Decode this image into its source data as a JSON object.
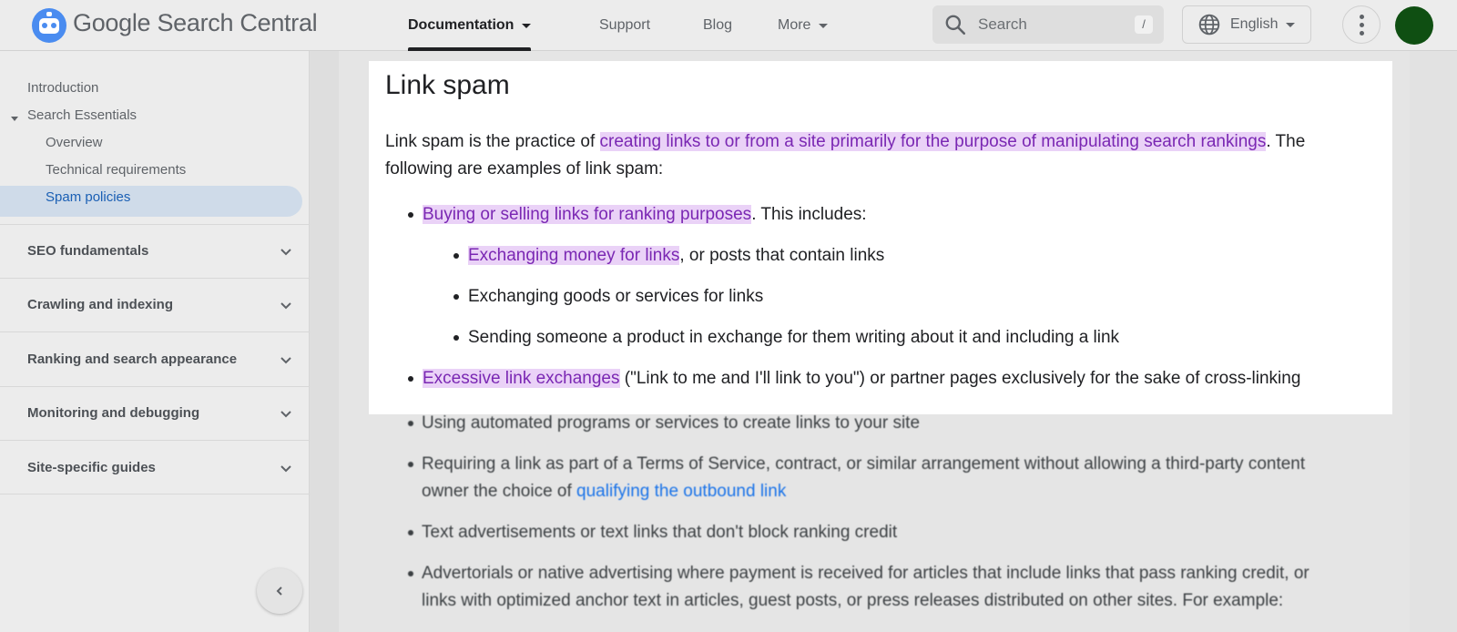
{
  "header": {
    "brand_google": "Google",
    "brand_rest": "Search Central",
    "nav": [
      {
        "label": "Documentation",
        "has_caret": true,
        "active": true
      },
      {
        "label": "Support"
      },
      {
        "label": "Blog"
      },
      {
        "label": "More",
        "has_caret": true
      }
    ],
    "search_placeholder": "Search",
    "search_shortcut": "/",
    "language": "English",
    "avatar_color": "#0f4f12"
  },
  "sidebar": {
    "items": [
      {
        "label": "Introduction"
      },
      {
        "label": "Search Essentials",
        "expanded": true
      },
      {
        "label": "Overview"
      },
      {
        "label": "Technical requirements"
      },
      {
        "label": "Spam policies",
        "active": true
      }
    ],
    "sections": [
      {
        "label": "SEO fundamentals"
      },
      {
        "label": "Crawling and indexing"
      },
      {
        "label": "Ranking and search appearance"
      },
      {
        "label": "Monitoring and debugging"
      },
      {
        "label": "Site-specific guides"
      }
    ]
  },
  "content": {
    "title": "Link spam",
    "intro_part1": "Link spam is the practice of ",
    "intro_highlight": "creating links to or from a site primarily for the purpose of manipulating search rankings",
    "intro_part2": ". The",
    "intro_line2": "following are examples of link spam:",
    "bullets": {
      "b1_highlight": "Buying or selling links for ranking purposes",
      "b1_rest": ". This includes:",
      "b1a_highlight": "Exchanging money for links",
      "b1a_rest": ", or posts that contain links",
      "b1b": "Exchanging goods or services for links",
      "b1c": "Sending someone a product in exchange for them writing about it and including a link",
      "b2_highlight": "Excessive link exchanges",
      "b2_rest": " (\"Link to me and I'll link to you\") or partner pages exclusively for the sake of cross-linking"
    },
    "blurred": {
      "b3": "Using automated programs or services to create links to your site",
      "b4_line1": "Requiring a link as part of a Terms of Service, contract, or similar arrangement without allowing a third-party content",
      "b4_line2_part1": "owner the choice of ",
      "b4_link": "qualifying the outbound link",
      "b5": "Text advertisements or text links that don't block ranking credit",
      "b6_line1": "Advertorials or native advertising where payment is received for articles that include links that pass ranking credit, or",
      "b6_line2": "links with optimized anchor text in articles, guest posts, or press releases distributed on other sites. For example:"
    }
  },
  "colors": {
    "highlight_bg": "#ead2f7",
    "highlight_text": "#7a27b3",
    "link": "#1a73e8",
    "active_nav_bg": "#cfdbe9"
  }
}
